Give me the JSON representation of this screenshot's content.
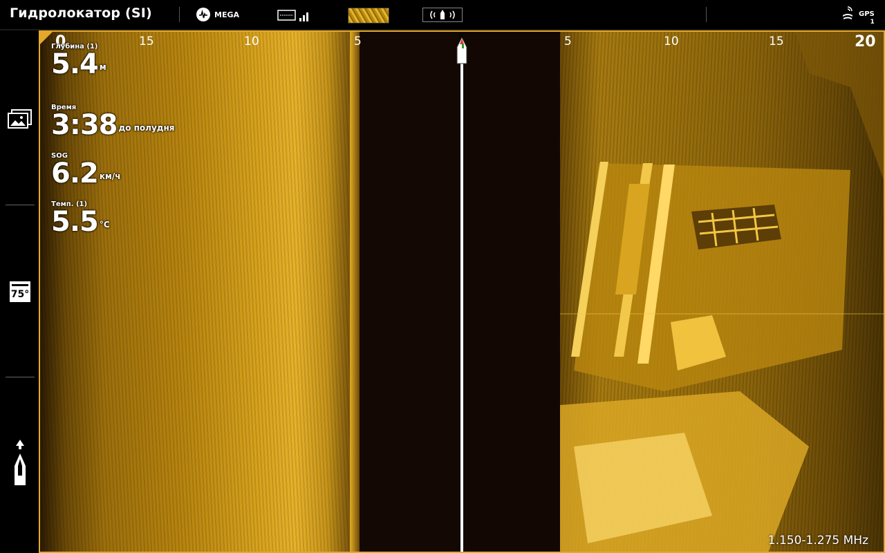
{
  "topbar": {
    "title": "Гидролокатор (SI)",
    "mega_label": "MEGA",
    "gps_label": "GPS",
    "gps_sub": "1"
  },
  "sidebar": {
    "icons": [
      "image-gallery-icon",
      "temperature-icon",
      "boat-heading-icon"
    ],
    "temp_badge": "75°"
  },
  "sonar": {
    "range_left": [
      "0",
      "15",
      "10",
      "5"
    ],
    "range_right": [
      "5",
      "10",
      "15",
      "20"
    ],
    "frequency": "1.150-1.275 MHz",
    "colors": {
      "accent": "#e6a82a",
      "sonar_bright": "#e7b22a",
      "sonar_dark": "#140804"
    }
  },
  "readouts": {
    "depth": {
      "label": "Глубина (1)",
      "value": "5.4",
      "unit": "м"
    },
    "time": {
      "label": "Время",
      "value": "3:38",
      "unit": "до полудня"
    },
    "sog": {
      "label": "SOG",
      "value": "6.2",
      "unit": "км/ч"
    },
    "temp": {
      "label": "Темп. (1)",
      "value": "5.5",
      "unit": "°C"
    }
  }
}
